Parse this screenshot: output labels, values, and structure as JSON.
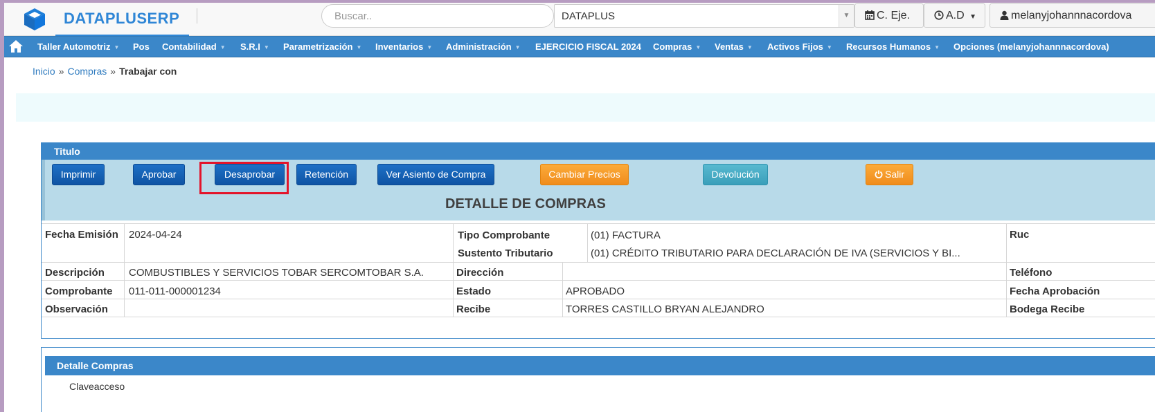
{
  "header": {
    "brand": "DATAPLUSERP",
    "search_placeholder": "Buscar..",
    "company": "DATAPLUS",
    "ceje_label": "C. Eje.",
    "ad_label": "A.D",
    "user_label": "melanyjohannnacordova"
  },
  "menu": {
    "items": [
      "Taller Automotriz",
      "Pos",
      "Contabilidad",
      "S.R.I",
      "Parametrización",
      "Inventarios",
      "Administración",
      "EJERCICIO FISCAL 2024",
      "Compras",
      "Ventas",
      "Activos Fijos",
      "Recursos Humanos",
      "Opciones (melanyjohannnacordova)"
    ]
  },
  "breadcrumb": {
    "home": "Inicio",
    "section": "Compras",
    "current": "Trabajar con"
  },
  "panel": {
    "title": "Titulo",
    "buttons": {
      "imprimir": "Imprimir",
      "aprobar": "Aprobar",
      "desaprobar": "Desaprobar",
      "retencion": "Retención",
      "asiento": "Ver Asiento de Compra",
      "cambiar": "Cambiar Precios",
      "devolucion": "Devolución",
      "salir": "Salir"
    },
    "detail_title": "DETALLE DE COMPRAS"
  },
  "detail": {
    "fecha_emision": {
      "label": "Fecha Emisión",
      "value": "2024-04-24"
    },
    "tipo_comprobante": {
      "label": "Tipo Comprobante",
      "value": "(01) FACTURA"
    },
    "sustento": {
      "label": "Sustento Tributario",
      "value": "(01) CRÉDITO TRIBUTARIO PARA DECLARACIÓN DE IVA (SERVICIOS Y BI..."
    },
    "ruc": {
      "label": "Ruc",
      "value": ""
    },
    "descripcion": {
      "label": "Descripción",
      "value": "COMBUSTIBLES Y SERVICIOS TOBAR SERCOMTOBAR S.A."
    },
    "direccion": {
      "label": "Dirección",
      "value": ""
    },
    "telefono": {
      "label": "Teléfono",
      "value": ""
    },
    "comprobante": {
      "label": "Comprobante",
      "value": "011-011-000001234"
    },
    "estado": {
      "label": "Estado",
      "value": "APROBADO"
    },
    "fecha_aprobacion": {
      "label": "Fecha Aprobación",
      "value": ""
    },
    "observacion": {
      "label": "Observación",
      "value": ""
    },
    "recibe": {
      "label": "Recibe",
      "value": "TORRES CASTILLO BRYAN ALEJANDRO"
    },
    "bodega": {
      "label": "Bodega Recibe",
      "value": ""
    }
  },
  "detalle_compras": {
    "title": "Detalle Compras",
    "clave_label": "Claveacceso"
  },
  "colors": {
    "brand": "#2f86d6",
    "menu_bg": "#3b87c9",
    "toolbar_bg": "#b8dae9",
    "btn_blue": "#0f54a4",
    "btn_orange": "#f08c1c",
    "btn_teal": "#3a9fba",
    "highlight": "#e3142a"
  },
  "icons": {
    "logo": "cube-icon",
    "home": "home-icon",
    "calendar": "calendar-icon",
    "clock": "clock-icon",
    "user": "user-icon",
    "power": "power-icon"
  }
}
